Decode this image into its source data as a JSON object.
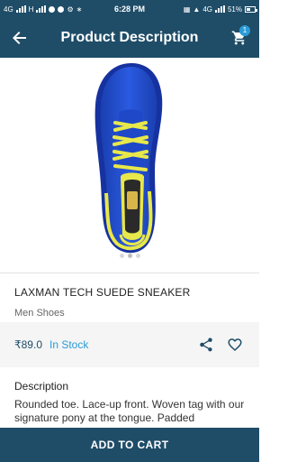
{
  "status_bar": {
    "left_text_1": "4G",
    "left_text_2": "H",
    "time": "6:28 PM",
    "network": "4G",
    "battery": "51%",
    "battery_level": 0.51
  },
  "app_bar": {
    "title": "Product Description",
    "cart_count": "1"
  },
  "product": {
    "image_icon": "sneaker-image",
    "name": "LAXMAN TECH SUEDE SNEAKER",
    "category": "Men Shoes",
    "price": "₹89.0",
    "stock_status": "In Stock",
    "description_title": "Description",
    "description_text": "Rounded toe. Lace-up front. Woven tag with our signature pony at the tongue. Padded"
  },
  "actions": {
    "add_to_cart": "ADD TO CART"
  },
  "colors": {
    "primary": "#1f4d68",
    "accent": "#2a9bd8",
    "shoe_blue": "#1e48c8",
    "shoe_yellow": "#e8e84a"
  },
  "pager": {
    "count": 3,
    "active_index": 1
  }
}
